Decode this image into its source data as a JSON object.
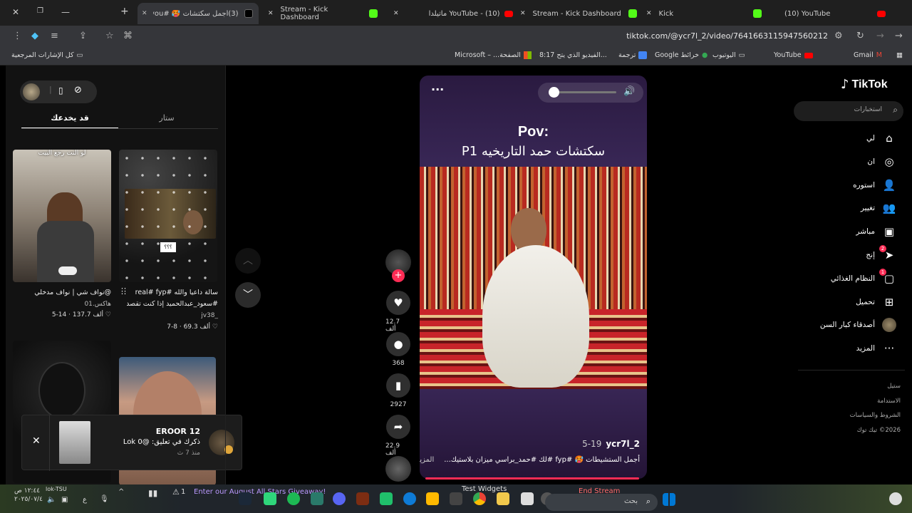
{
  "tabs": [
    {
      "label": "(3)أجمل سكتشات 🥵 #foryou"
    },
    {
      "label": "Stream - Kick Dashboard"
    },
    {
      "label": "YouTube - (10) ماتيلدا"
    },
    {
      "label": "Stream - Kick Dashboard"
    },
    {
      "label": "Kick"
    },
    {
      "label": "(10) YouTube"
    }
  ],
  "address": {
    "url": "tiktok.com/@ycr7l_2/video/7641663115947560212"
  },
  "bookmarks": {
    "all_label": "كل الإشارات المرجعية",
    "items": [
      {
        "label": "Microsoft – ...الصفحة"
      },
      {
        "label": "8:17 الفيديو الذي يتح..."
      },
      {
        "label": "ترجمة"
      },
      {
        "label": "Google خرائط"
      },
      {
        "label": "اليوتيوب"
      },
      {
        "label": "YouTube"
      },
      {
        "label": "Gmail"
      }
    ]
  },
  "sidebar": {
    "logo": "TikTok",
    "search_placeholder": "استخبارات",
    "nav": [
      {
        "label": "لي",
        "icon": "home-icon"
      },
      {
        "label": "ان",
        "icon": "compass-icon"
      },
      {
        "label": "استوره",
        "icon": "user-plus-icon"
      },
      {
        "label": "تغيير",
        "icon": "users-icon"
      },
      {
        "label": "مباشر",
        "icon": "live-icon"
      },
      {
        "label": "إنج",
        "icon": "send-icon",
        "badge": "2"
      },
      {
        "label": "النظام الغذائي",
        "icon": "message-icon",
        "badge": "1"
      },
      {
        "label": "تحميل",
        "icon": "upload-icon"
      },
      {
        "label": "أصدقاء كبار السن",
        "icon": "avatar-icon"
      },
      {
        "label": "المزيد",
        "icon": "more-icon"
      }
    ],
    "footer": [
      "ستيل",
      "الاستدامة",
      "الشروط والسياسات",
      "2026© تيك توك"
    ]
  },
  "video": {
    "overlay_title": "Pov:",
    "overlay_subtitle": "سكتشات حمد التاريخيه P1",
    "author": "ycr7l_2",
    "date": "5-19",
    "caption": "أجمل الستشيطات 🥵 #fyp #لك #حمد_براسي ميزان بلاستيك...",
    "more_label": "المزيد",
    "volume_level": 0.05
  },
  "actions": {
    "likes": "12.7 ألف",
    "comments": "368",
    "saves": "2927",
    "shares": "22.9 ألف"
  },
  "panel": {
    "tabs": [
      "ستار",
      "قد يخدعك"
    ],
    "active_tab": "قد يخدعك",
    "videos": [
      {
        "overlay": "لو النت رجع البيت",
        "caption": "@نواف شي | نواف مدخلي",
        "sub": "هاكس.01",
        "likes": "137.7 ألف",
        "date": "5-14"
      },
      {
        "overlay": "؟؟؟",
        "caption": "سالة داعيا والله #real# fyp",
        "caption2": "#سعود_عبدالحميد إذا كنت تقصد...",
        "sub": "jv38_",
        "likes": "69.3 ألف",
        "date": "7-8"
      }
    ]
  },
  "notification": {
    "title": "EROOR 12",
    "text": "ذكرك في تعليق: @Lok 0",
    "time": "منذ 7 ث"
  },
  "taskbar": {
    "time": "١٢:٤٤ ص",
    "date": "٢٠٢٥/٠٧/٤",
    "user": "lok-TSU",
    "banner": "Enter our August All Stars Giveaway!",
    "test_widgets": "Test Widgets",
    "end_stream": "End Stream",
    "search": "بحث",
    "alert_count": "1",
    "lang": "ع"
  }
}
